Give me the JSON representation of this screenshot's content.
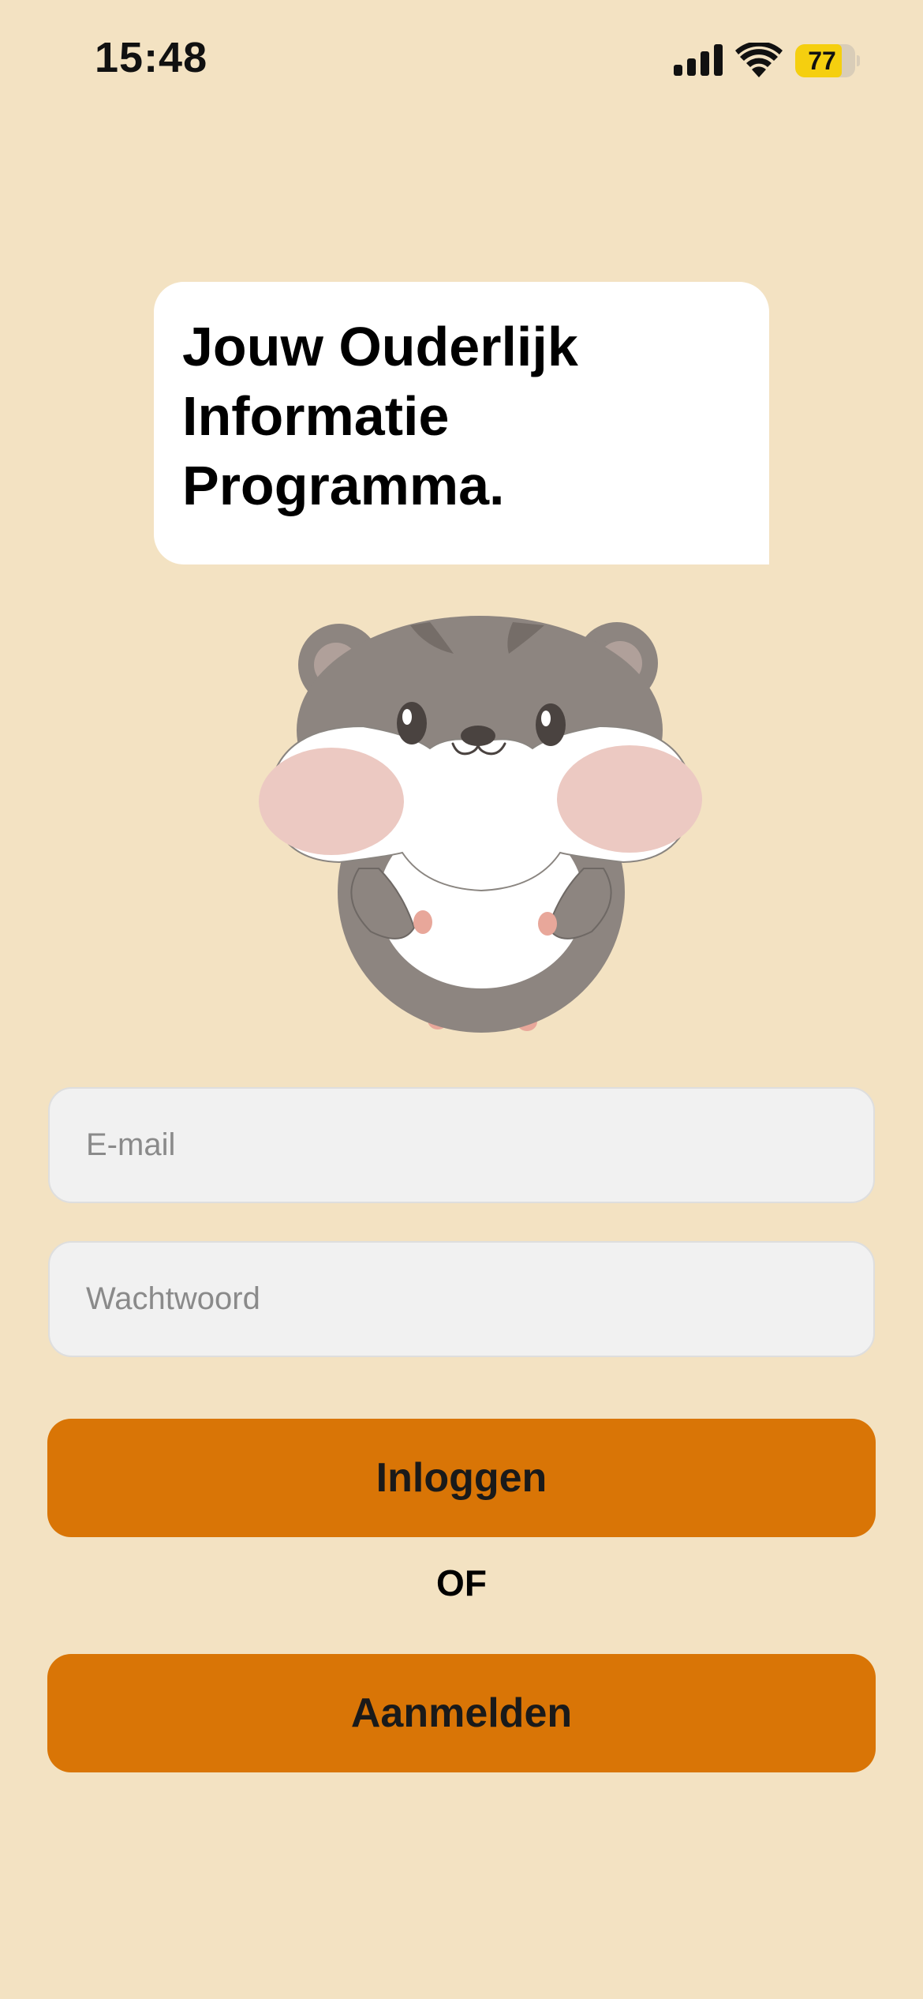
{
  "status_bar": {
    "time": "15:48",
    "battery_level": "77",
    "battery_fraction": 0.77,
    "icons": [
      "signal-icon",
      "wifi-icon",
      "battery-icon"
    ]
  },
  "header": {
    "title": "Jouw Ouderlijk\nInformatie\nProgramma."
  },
  "mascot": {
    "icon": "hamster-mascot"
  },
  "form": {
    "email_placeholder": "E-mail",
    "email_value": "",
    "password_placeholder": "Wachtwoord",
    "password_value": ""
  },
  "actions": {
    "login_label": "Inloggen",
    "or_label": "OF",
    "register_label": "Aanmelden"
  },
  "colors": {
    "background": "#f3e2c2",
    "accent": "#d97506",
    "battery": "#f5cf0f"
  }
}
